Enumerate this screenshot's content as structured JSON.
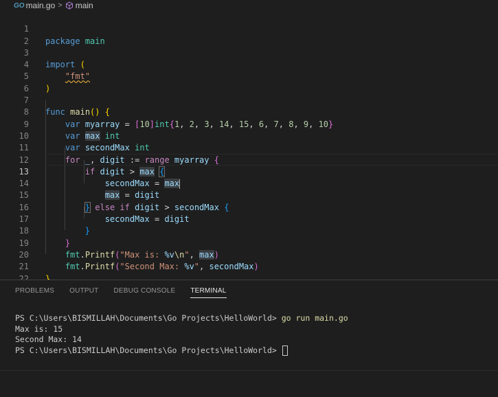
{
  "breadcrumb": {
    "file_icon": "GO",
    "file": "main.go",
    "separator": ">",
    "symbol": "main"
  },
  "editor": {
    "current_line": 13,
    "lines": [
      {
        "n": "1",
        "code": "package main"
      },
      {
        "n": "2",
        "code": ""
      },
      {
        "n": "3",
        "code": "import ("
      },
      {
        "n": "4",
        "code": "    \"fmt\""
      },
      {
        "n": "5",
        "code": ")"
      },
      {
        "n": "6",
        "code": ""
      },
      {
        "n": "7",
        "code": "func main() {"
      },
      {
        "n": "8",
        "code": "    var myarray = [10]int{1, 2, 3, 14, 15, 6, 7, 8, 9, 10}"
      },
      {
        "n": "9",
        "code": "    var max int"
      },
      {
        "n": "10",
        "code": "    var secondMax int"
      },
      {
        "n": "11",
        "code": "    for _, digit := range myarray {"
      },
      {
        "n": "12",
        "code": "        if digit > max {"
      },
      {
        "n": "13",
        "code": "            secondMax = max"
      },
      {
        "n": "14",
        "code": "            max = digit"
      },
      {
        "n": "15",
        "code": "        } else if digit > secondMax {"
      },
      {
        "n": "16",
        "code": "            secondMax = digit"
      },
      {
        "n": "17",
        "code": "        }"
      },
      {
        "n": "18",
        "code": "    }"
      },
      {
        "n": "19",
        "code": "    fmt.Printf(\"Max is: %v\\n\", max)"
      },
      {
        "n": "20",
        "code": "    fmt.Printf(\"Second Max: %v\", secondMax)"
      },
      {
        "n": "21",
        "code": "}"
      },
      {
        "n": "22",
        "code": ""
      }
    ]
  },
  "panel": {
    "tabs": [
      "PROBLEMS",
      "OUTPUT",
      "DEBUG CONSOLE",
      "TERMINAL"
    ],
    "active_tab": "TERMINAL",
    "terminal": {
      "prompt1": "PS C:\\Users\\BISMILLAH\\Documents\\Go Projects\\HelloWorld> ",
      "command1": "go run main.go",
      "output": [
        "Max is: 15",
        "Second Max: 14"
      ],
      "prompt2": "PS C:\\Users\\BISMILLAH\\Documents\\Go Projects\\HelloWorld> "
    }
  },
  "colors": {
    "background": "#1e1e1e",
    "keyword": "#569cd6",
    "control_keyword": "#c586c0",
    "function": "#dcdcaa",
    "variable": "#9cdcfe",
    "type": "#4ec9b0",
    "number": "#b5cea8",
    "string": "#ce9178"
  }
}
